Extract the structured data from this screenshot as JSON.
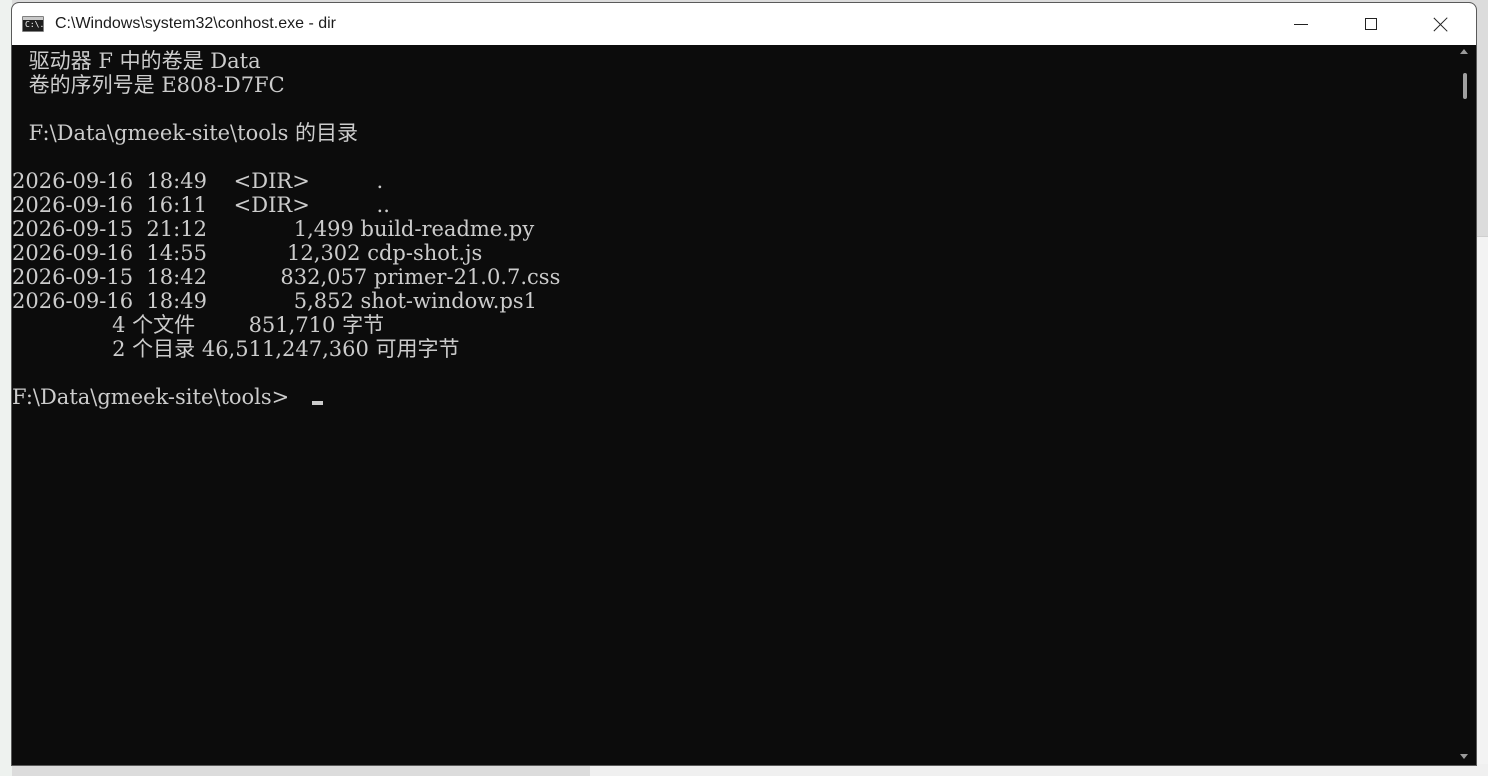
{
  "window": {
    "title": "C:\\Windows\\system32\\conhost.exe - dir",
    "icon": "console-icon",
    "icon_glyph": "C:\\."
  },
  "console": {
    "lines": [
      " 驱动器 F 中的卷是 Data",
      " 卷的序列号是 E808-D7FC",
      "",
      " F:\\Data\\gmeek-site\\tools 的目录",
      "",
      "2026-09-16  18:49    <DIR>          .",
      "2026-09-16  16:11    <DIR>          ..",
      "2026-09-15  21:12             1,499 build-readme.py",
      "2026-09-16  14:55            12,302 cdp-shot.js",
      "2026-09-15  18:42           832,057 primer-21.0.7.css",
      "2026-09-16  18:49             5,852 shot-window.ps1",
      "               4 个文件        851,710 字节",
      "               2 个目录 46,511,247,360 可用字节",
      "",
      "F:\\Data\\gmeek-site\\tools>"
    ]
  },
  "colors": {
    "console_bg": "#0c0c0c",
    "console_fg": "#cccccc",
    "titlebar_bg": "#ffffff"
  }
}
